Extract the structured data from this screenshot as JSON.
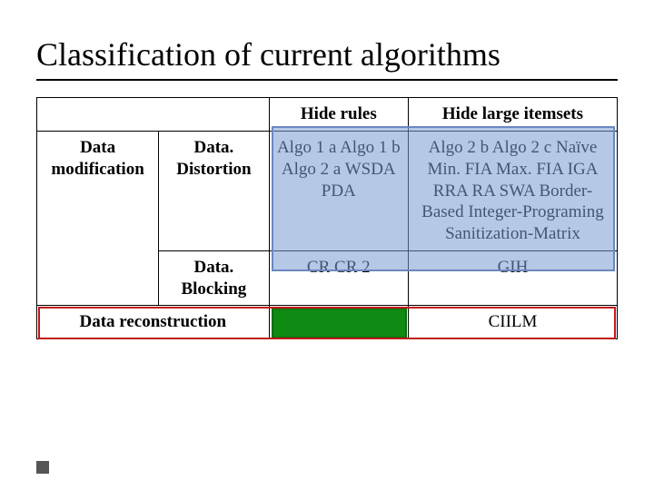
{
  "title": "Classification of current algorithms",
  "headers": {
    "empty": "",
    "hide_rules": "Hide rules",
    "hide_large": "Hide large itemsets"
  },
  "rows": {
    "data_modification": "Data modification",
    "data_distortion": "Data. Distortion",
    "data_blocking": "Data. Blocking",
    "data_reconstruction": "Data reconstruction"
  },
  "cells": {
    "distortion_rules": "Algo 1 a Algo 1 b Algo 2 a WSDA PDA",
    "distortion_large": "Algo 2 b Algo 2 c Naïve Min. FIA Max. FIA IGA RRA RA SWA Border-Based Integer-Programing Sanitization-Matrix",
    "blocking_rules": "CR CR 2",
    "blocking_large": "GIH",
    "reconstruction_rules": "",
    "reconstruction_large": "CIILM"
  }
}
